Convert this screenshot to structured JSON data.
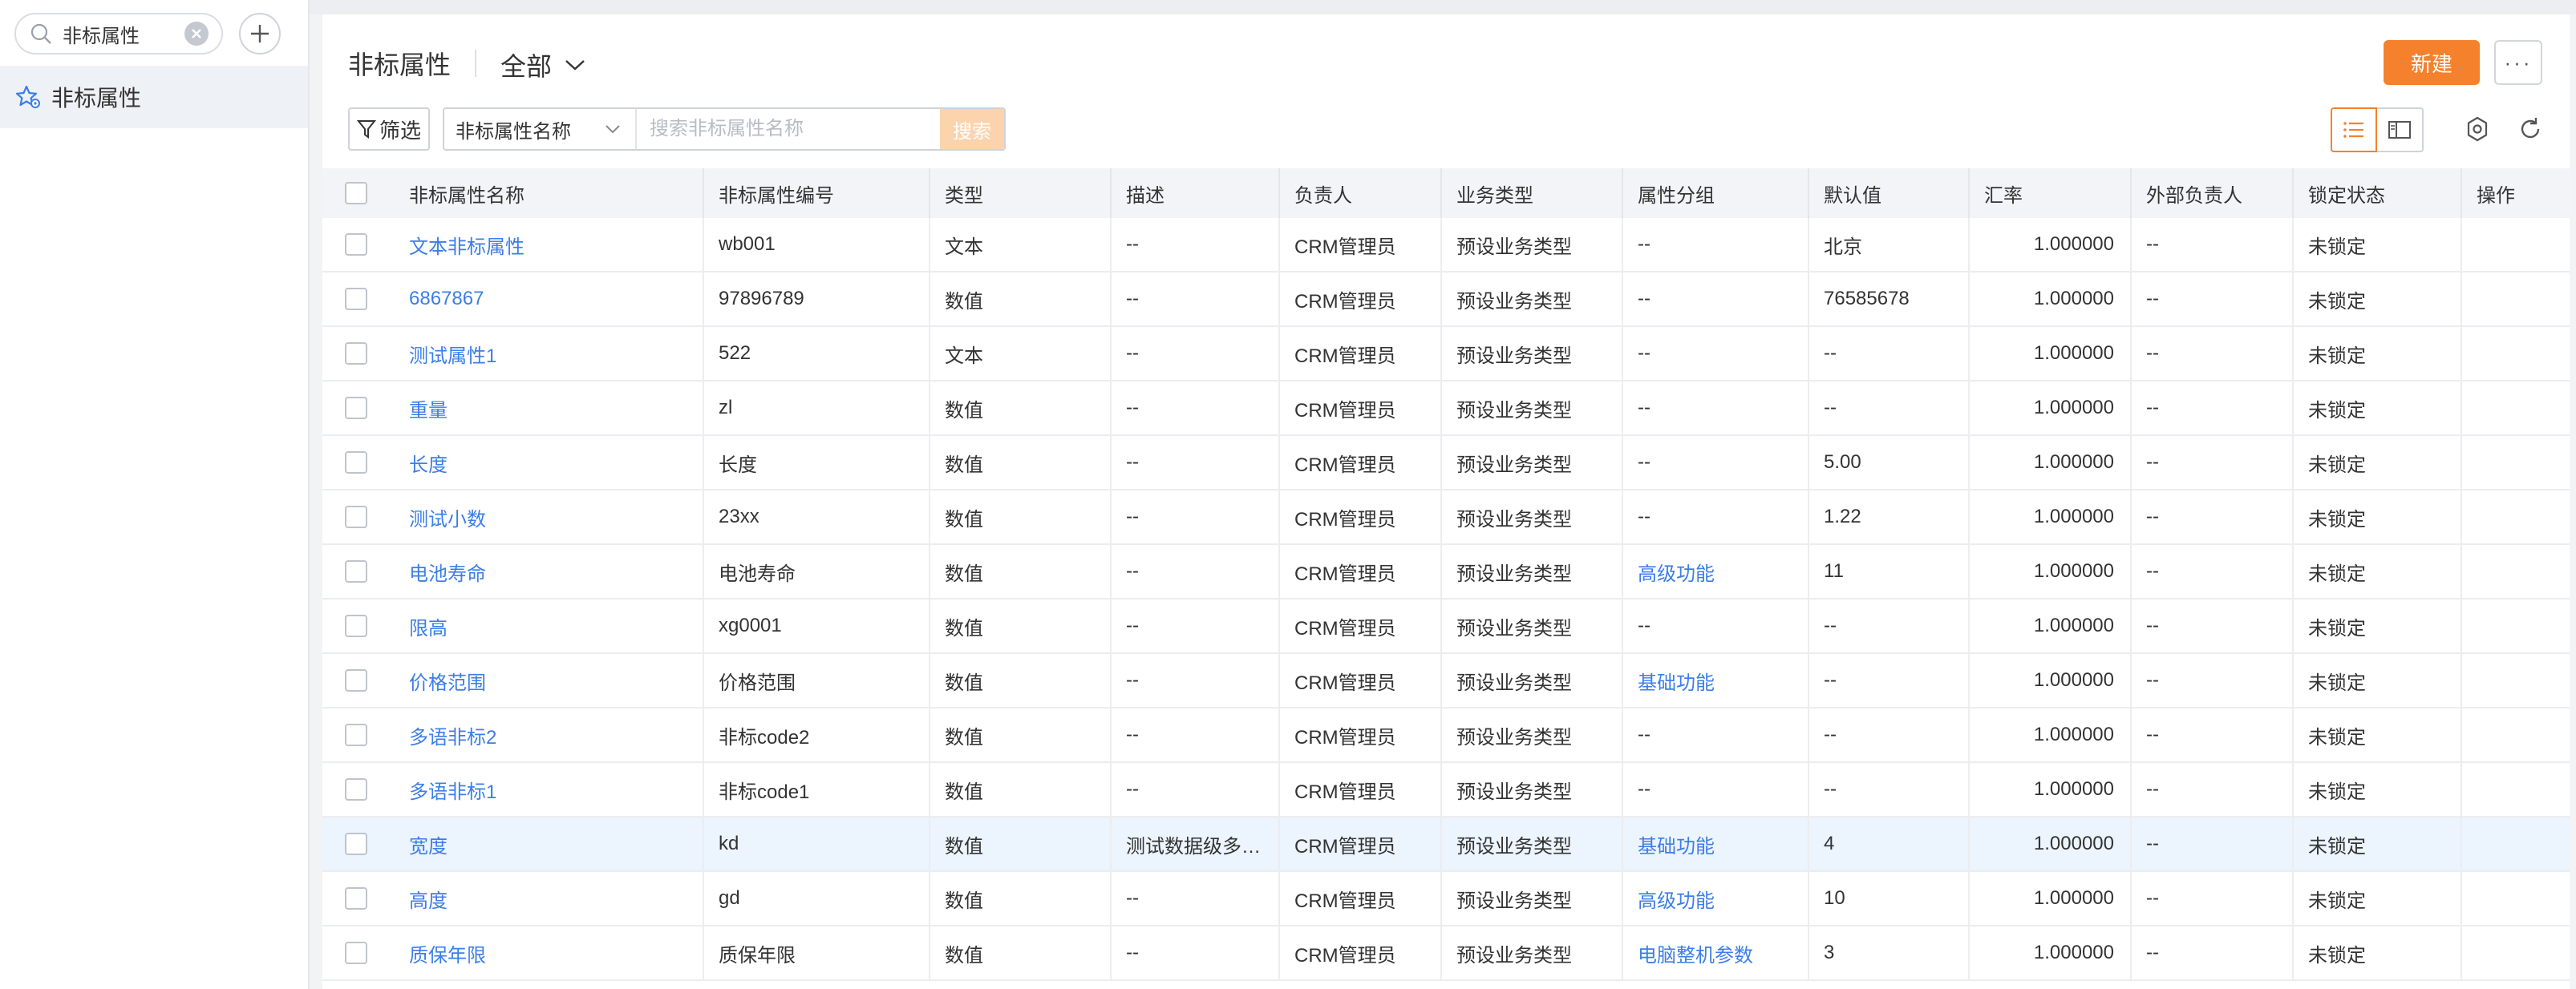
{
  "sidebar": {
    "search_value": "非标属性",
    "items": [
      {
        "label": "非标属性"
      }
    ]
  },
  "header": {
    "title": "非标属性",
    "scope": "全部",
    "new_label": "新建",
    "more_label": "···"
  },
  "toolbar": {
    "filter_label": "筛选",
    "field_select": "非标属性名称",
    "search_placeholder": "搜索非标属性名称",
    "search_label": "搜索"
  },
  "table": {
    "columns": [
      "非标属性名称",
      "非标属性编号",
      "类型",
      "描述",
      "负责人",
      "业务类型",
      "属性分组",
      "默认值",
      "汇率",
      "外部负责人",
      "锁定状态",
      "操作"
    ],
    "rows": [
      {
        "name": "文本非标属性",
        "code": "wb001",
        "type": "文本",
        "desc": "--",
        "owner": "CRM管理员",
        "biz": "预设业务类型",
        "group": "--",
        "group_link": false,
        "default": "北京",
        "rate": "1.000000",
        "ext": "--",
        "lock": "未锁定"
      },
      {
        "name": "6867867",
        "code": "97896789",
        "type": "数值",
        "desc": "--",
        "owner": "CRM管理员",
        "biz": "预设业务类型",
        "group": "--",
        "group_link": false,
        "default": "76585678",
        "rate": "1.000000",
        "ext": "--",
        "lock": "未锁定"
      },
      {
        "name": "测试属性1",
        "code": "522",
        "type": "文本",
        "desc": "--",
        "owner": "CRM管理员",
        "biz": "预设业务类型",
        "group": "--",
        "group_link": false,
        "default": "--",
        "rate": "1.000000",
        "ext": "--",
        "lock": "未锁定"
      },
      {
        "name": "重量",
        "code": "zl",
        "type": "数值",
        "desc": "--",
        "owner": "CRM管理员",
        "biz": "预设业务类型",
        "group": "--",
        "group_link": false,
        "default": "--",
        "rate": "1.000000",
        "ext": "--",
        "lock": "未锁定"
      },
      {
        "name": "长度",
        "code": "长度",
        "type": "数值",
        "desc": "--",
        "owner": "CRM管理员",
        "biz": "预设业务类型",
        "group": "--",
        "group_link": false,
        "default": "5.00",
        "rate": "1.000000",
        "ext": "--",
        "lock": "未锁定"
      },
      {
        "name": "测试小数",
        "code": "23xx",
        "type": "数值",
        "desc": "--",
        "owner": "CRM管理员",
        "biz": "预设业务类型",
        "group": "--",
        "group_link": false,
        "default": "1.22",
        "rate": "1.000000",
        "ext": "--",
        "lock": "未锁定"
      },
      {
        "name": "电池寿命",
        "code": "电池寿命",
        "type": "数值",
        "desc": "--",
        "owner": "CRM管理员",
        "biz": "预设业务类型",
        "group": "高级功能",
        "group_link": true,
        "default": "11",
        "rate": "1.000000",
        "ext": "--",
        "lock": "未锁定"
      },
      {
        "name": "限高",
        "code": "xg0001",
        "type": "数值",
        "desc": "--",
        "owner": "CRM管理员",
        "biz": "预设业务类型",
        "group": "--",
        "group_link": false,
        "default": "--",
        "rate": "1.000000",
        "ext": "--",
        "lock": "未锁定"
      },
      {
        "name": "价格范围",
        "code": "价格范围",
        "type": "数值",
        "desc": "--",
        "owner": "CRM管理员",
        "biz": "预设业务类型",
        "group": "基础功能",
        "group_link": true,
        "default": "--",
        "rate": "1.000000",
        "ext": "--",
        "lock": "未锁定"
      },
      {
        "name": "多语非标2",
        "code": "非标code2",
        "type": "数值",
        "desc": "--",
        "owner": "CRM管理员",
        "biz": "预设业务类型",
        "group": "--",
        "group_link": false,
        "default": "--",
        "rate": "1.000000",
        "ext": "--",
        "lock": "未锁定"
      },
      {
        "name": "多语非标1",
        "code": "非标code1",
        "type": "数值",
        "desc": "--",
        "owner": "CRM管理员",
        "biz": "预设业务类型",
        "group": "--",
        "group_link": false,
        "default": "--",
        "rate": "1.000000",
        "ext": "--",
        "lock": "未锁定"
      },
      {
        "name": "宽度",
        "code": "kd",
        "type": "数值",
        "desc": "测试数据级多…",
        "owner": "CRM管理员",
        "biz": "预设业务类型",
        "group": "基础功能",
        "group_link": true,
        "default": "4",
        "rate": "1.000000",
        "ext": "--",
        "lock": "未锁定"
      },
      {
        "name": "高度",
        "code": "gd",
        "type": "数值",
        "desc": "--",
        "owner": "CRM管理员",
        "biz": "预设业务类型",
        "group": "高级功能",
        "group_link": true,
        "default": "10",
        "rate": "1.000000",
        "ext": "--",
        "lock": "未锁定"
      },
      {
        "name": "质保年限",
        "code": "质保年限",
        "type": "数值",
        "desc": "--",
        "owner": "CRM管理员",
        "biz": "预设业务类型",
        "group": "电脑整机参数",
        "group_link": true,
        "default": "3",
        "rate": "1.000000",
        "ext": "--",
        "lock": "未锁定"
      }
    ],
    "highlight_row": 11
  }
}
